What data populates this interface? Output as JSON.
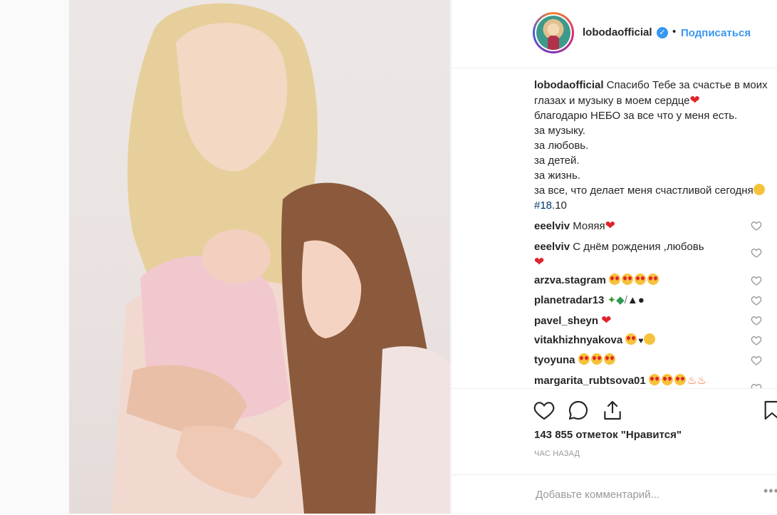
{
  "header": {
    "username": "lobodaofficial",
    "verified_mark": "✓",
    "separator": "•",
    "follow_label": "Подписаться"
  },
  "caption": {
    "username": "lobodaofficial",
    "line1": "Спасибо Тебе за счастье в моих глазах и музыку в моем сердце",
    "line2": "благодарю НЕБО за все что у меня есть.",
    "line3": "за музыку.",
    "line4": "за любовь.",
    "line5": "за детей.",
    "line6": "за жизнь.",
    "line7": "за все, что делает меня счастливой сегодня",
    "hashtag": "#18",
    "tail": ".10"
  },
  "comments": [
    {
      "username": "eeelviv",
      "text": "Мояяя",
      "icons": [
        "red-heart"
      ]
    },
    {
      "username": "eeelviv",
      "text": "С днём рождения ,любовь",
      "icons": [
        "red-heart"
      ]
    },
    {
      "username": "arzva.stagram",
      "text": "",
      "icons": [
        "heart-eyes",
        "heart-eyes",
        "heart-eyes",
        "heart-eyes"
      ]
    },
    {
      "username": "planetradar13",
      "text": "",
      "icons": [
        "cactus",
        "shield",
        "sword",
        "graduation-cap",
        "bomb"
      ]
    },
    {
      "username": "pavel_sheyn",
      "text": "",
      "icons": [
        "red-heart"
      ]
    },
    {
      "username": "vitakhizhnyakova",
      "text": "",
      "icons": [
        "heart-eyes",
        "black-heart",
        "kiss-face"
      ]
    },
    {
      "username": "tyoyuna",
      "text": "",
      "icons": [
        "heart-eyes",
        "heart-eyes",
        "heart-eyes"
      ]
    },
    {
      "username": "margarita_rubtsova01",
      "text": "",
      "icons": [
        "heart-eyes",
        "heart-eyes",
        "heart-eyes",
        "fire",
        "fire"
      ]
    }
  ],
  "actions": {
    "likes_text": "143 855 отметок \"Нравится\"",
    "time_text": "ЧАС НАЗАД",
    "comment_placeholder": "Добавьте комментарий...",
    "more_label": "•••"
  },
  "colors": {
    "link_blue": "#3897f0",
    "hashtag_blue": "#003569",
    "text": "#262626",
    "muted": "#999999",
    "heart_red": "#e0232b"
  }
}
